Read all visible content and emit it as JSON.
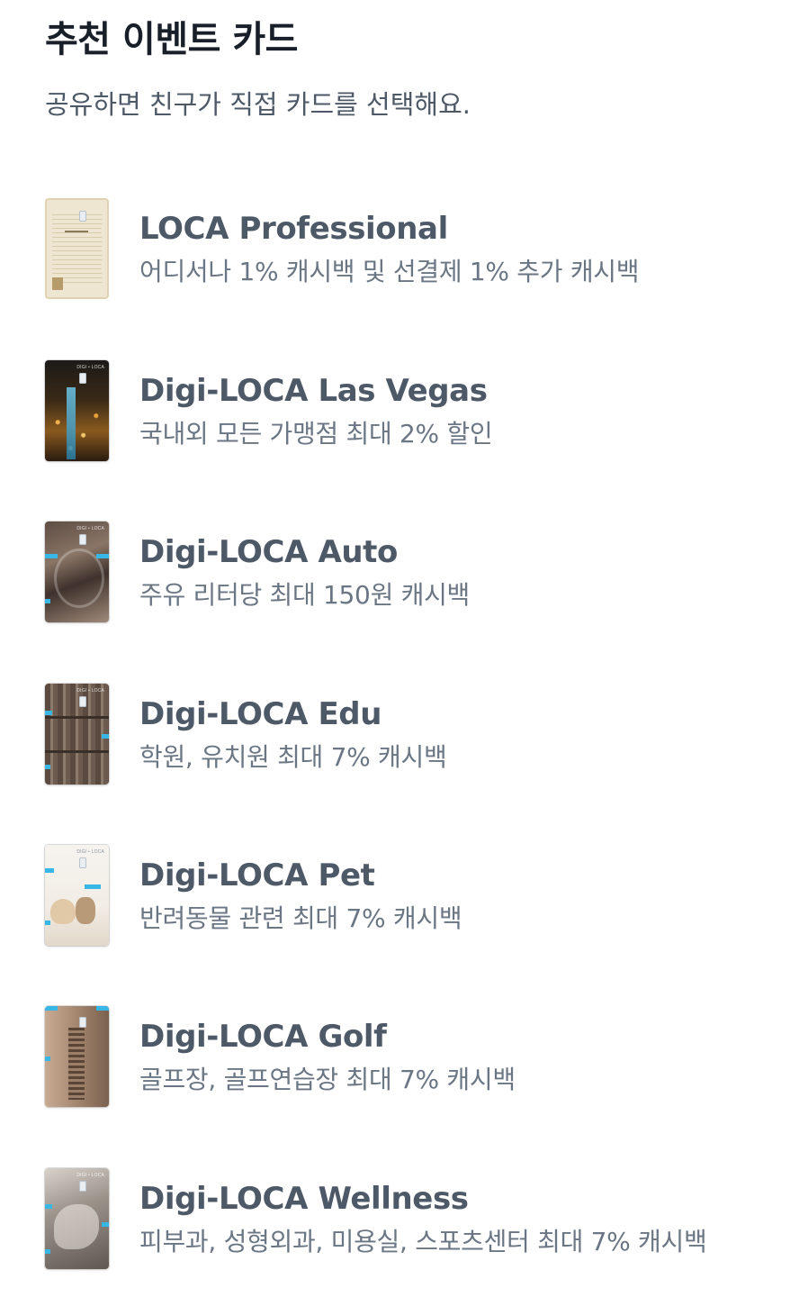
{
  "header": {
    "title": "추천 이벤트 카드",
    "subtitle": "공유하면 친구가 직접 카드를 선택해요."
  },
  "cards": [
    {
      "name": "LOCA Professional",
      "description": "어디서나 1% 캐시백 및 선결제 1% 추가 캐시백",
      "art": "newspaper-scale-card-art"
    },
    {
      "name": "Digi-LOCA Las Vegas",
      "description": "국내외 모든 가맹점 최대 2% 할인",
      "art": "las-vegas-night-card-art",
      "brand_text": "DIGI • LOCA"
    },
    {
      "name": "Digi-LOCA Auto",
      "description": "주유 리터당 최대 150원 캐시백",
      "art": "car-interior-card-art",
      "brand_text": "DIGI • LOCA"
    },
    {
      "name": "Digi-LOCA Edu",
      "description": "학원, 유치원 최대 7% 캐시백",
      "art": "bookshelf-card-art",
      "brand_text": "DIGI • LOCA"
    },
    {
      "name": "Digi-LOCA Pet",
      "description": "반려동물 관련 최대 7% 캐시백",
      "art": "dog-and-cat-card-art",
      "brand_text": "DIGI • LOCA"
    },
    {
      "name": "Digi-LOCA Golf",
      "description": "골프장, 골프연습장 최대 7% 캐시백",
      "art": "golf-clubhouse-card-art",
      "brand_text": "DIGI • LOCA"
    },
    {
      "name": "Digi-LOCA Wellness",
      "description": "피부과, 성형외과, 미용실, 스포츠센터 최대 7% 캐시백",
      "art": "spa-wellness-card-art",
      "brand_text": "DIGI • LOCA"
    }
  ],
  "colors": {
    "title": "#191f28",
    "subtitle": "#4e5968",
    "card_name": "#4e5968",
    "card_desc": "#6b7684",
    "accent": "#37b7e6"
  }
}
